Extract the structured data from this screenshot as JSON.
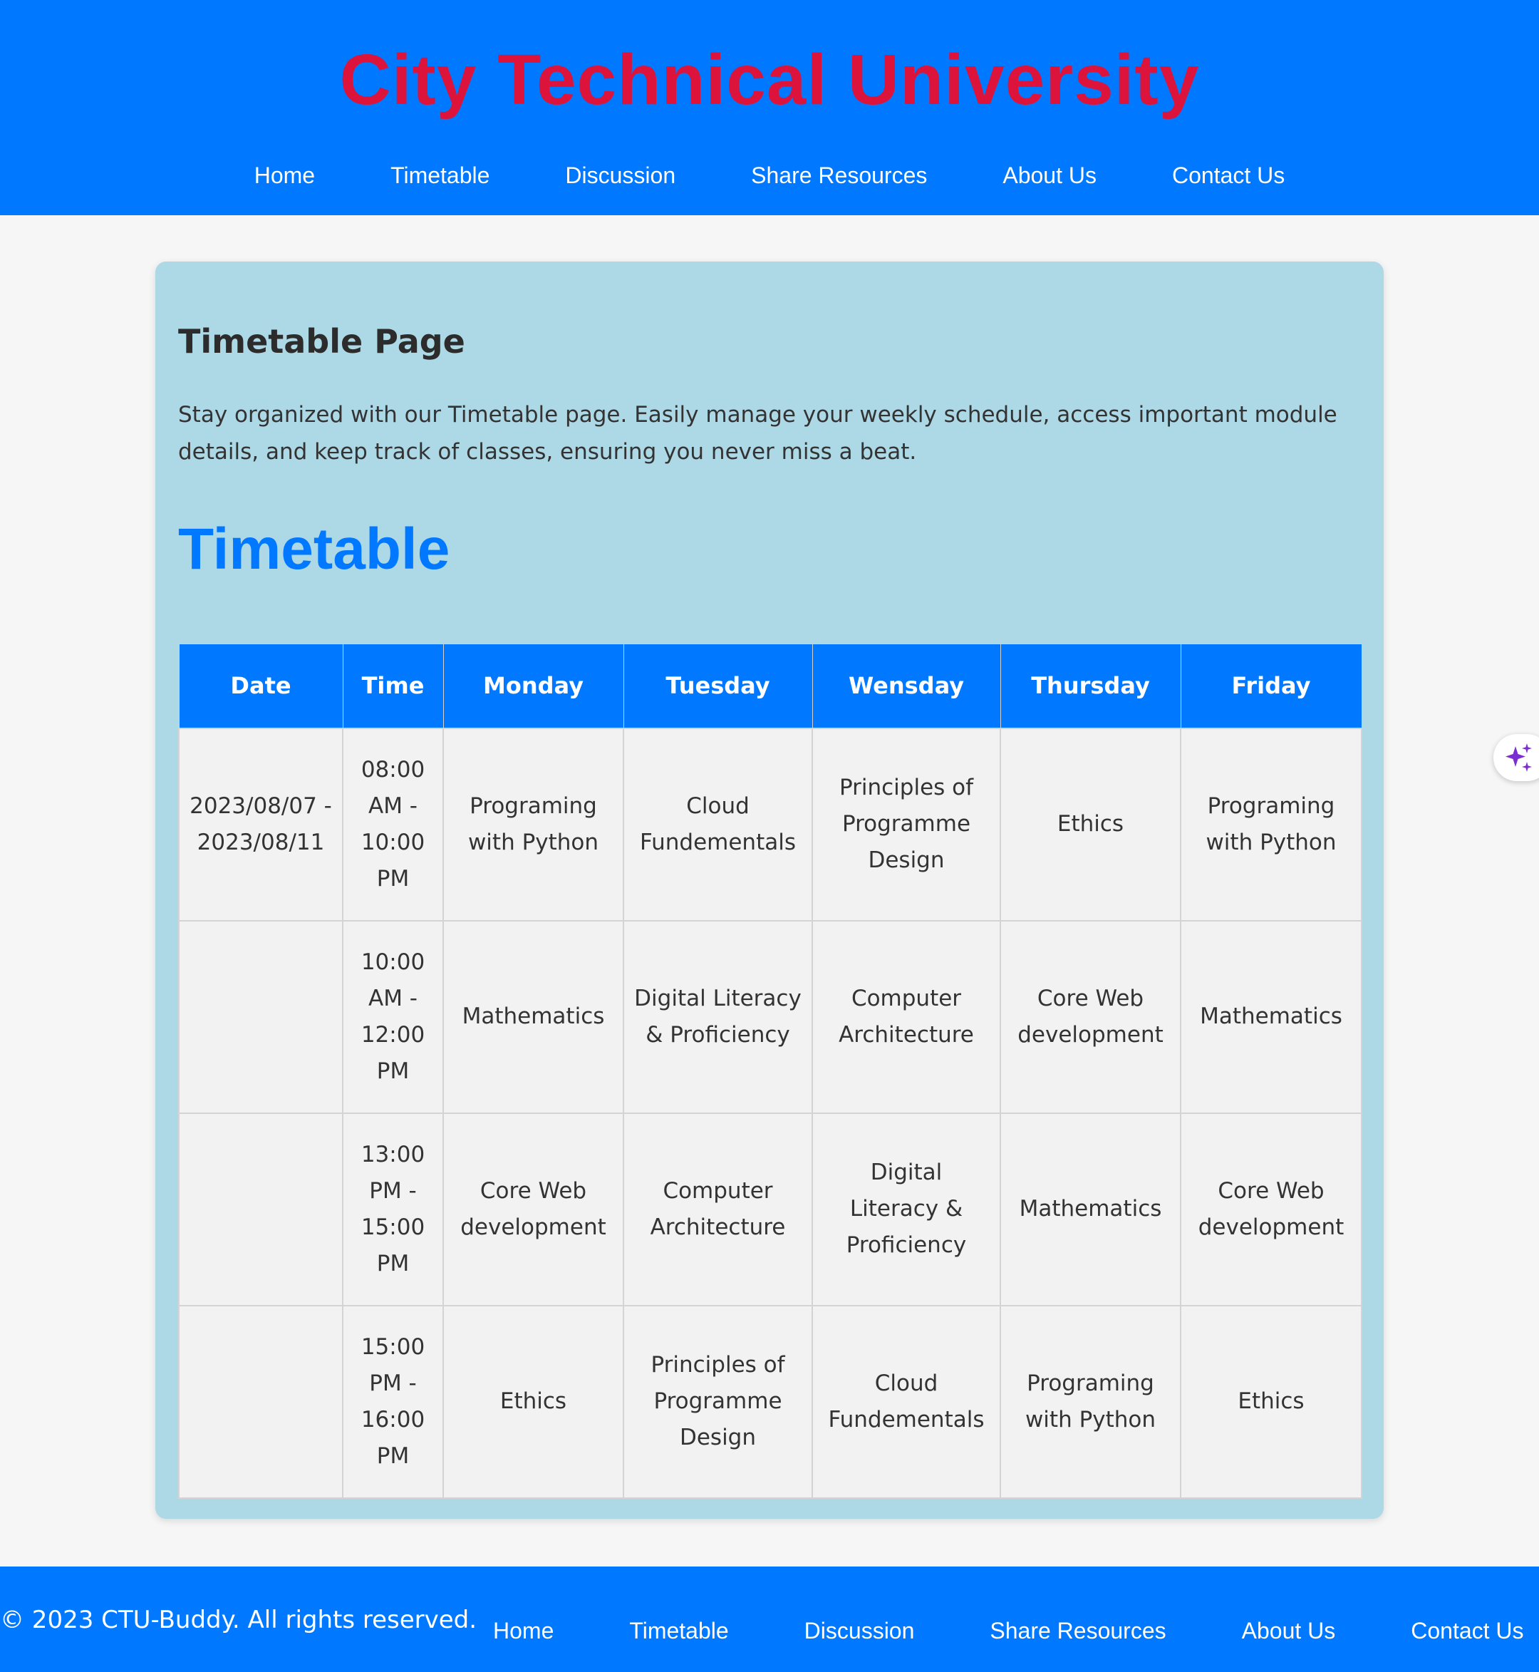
{
  "header": {
    "title": "City Technical University",
    "nav": [
      "Home",
      "Timetable",
      "Discussion",
      "Share Resources",
      "About Us",
      "Contact Us"
    ]
  },
  "main": {
    "heading": "Timetable Page",
    "intro": "Stay organized with our Timetable page. Easily manage your weekly schedule, access important module details, and keep track of classes, ensuring you never miss a beat.",
    "section_title": "Timetable",
    "table": {
      "headers": [
        "Date",
        "Time",
        "Monday",
        "Tuesday",
        "Wensday",
        "Thursday",
        "Friday"
      ],
      "rows": [
        [
          "2023/08/07 - 2023/08/11",
          "08:00 AM - 10:00 PM",
          "Programing with Python",
          "Cloud Fundementals",
          "Principles of Programme Design",
          "Ethics",
          "Programing with Python"
        ],
        [
          "",
          "10:00 AM - 12:00 PM",
          "Mathematics",
          "Digital Literacy & Proficiency",
          "Computer Architecture",
          "Core Web development",
          "Mathematics"
        ],
        [
          "",
          "13:00 PM - 15:00 PM",
          "Core Web development",
          "Computer Architecture",
          "Digital Literacy & Proficiency",
          "Mathematics",
          "Core Web development"
        ],
        [
          "",
          "15:00 PM - 16:00 PM",
          "Ethics",
          "Principles of Programme Design",
          "Cloud Fundementals",
          "Programing with Python",
          "Ethics"
        ]
      ]
    }
  },
  "footer": {
    "copyright": "© 2023 CTU-Buddy. All rights reserved.",
    "nav": [
      "Home",
      "Timetable",
      "Discussion",
      "Share Resources",
      "About Us",
      "Contact Us"
    ]
  },
  "assistant": {
    "icon": "sparkle-icon",
    "color": "#7b2fd0"
  },
  "colors": {
    "brand_blue": "#0078ff",
    "title_red": "#dc143c",
    "card_bg": "#add8e6"
  }
}
